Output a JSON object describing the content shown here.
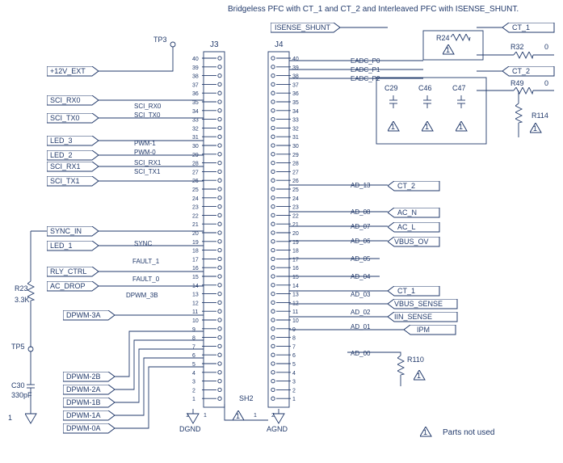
{
  "title": "Bridgeless PFC with CT_1 and CT_2 and Interleaved PFC with ISENSE_SHUNT.",
  "parts_note": "Parts not used",
  "refs": {
    "tp3": "TP3",
    "tp5": "TP5",
    "sh2": "SH2",
    "j3": "J3",
    "j4": "J4",
    "r23": "R23",
    "r23_val": "3.3K",
    "c30": "C30",
    "c30_val": "330pF",
    "r24": "R24",
    "r32": "R32",
    "r49": "R49",
    "r32_val": "0",
    "r49_val": "0",
    "r110": "R110",
    "r114": "R114",
    "c29": "C29",
    "c46": "C46",
    "c47": "C47",
    "dgnd": "DGND",
    "agnd": "AGND"
  },
  "triangle_marks": {
    "r24": "1",
    "c29": "1",
    "c46": "1",
    "c47": "1",
    "r114": "1",
    "r110": "1",
    "legend": "1",
    "big": "1",
    "c30_gnd": "1"
  },
  "left_signals": {
    "plus12v": "+12V_EXT",
    "sci_rx0": "SCI_RX0",
    "sci_tx0": "SCI_TX0",
    "led3": "LED_3",
    "led2": "LED_2",
    "sci_rx1": "SCI_RX1",
    "sci_tx1": "SCI_TX1",
    "sync_in": "SYNC_IN",
    "led1": "LED_1",
    "rly_ctrl": "RLY_CTRL",
    "ac_drop": "AC_DROP",
    "dpwm3a": "DPWM-3A",
    "dpwm2b": "DPWM-2B",
    "dpwm2a": "DPWM-2A",
    "dpwm1b": "DPWM-1B",
    "dpwm1a": "DPWM-1A",
    "dpwm0a": "DPWM-0A",
    "isense_shunt": "ISENSE_SHUNT"
  },
  "net_labels_j3": {
    "sync": "SYNC",
    "fault1": "FAULT_1",
    "fault0": "FAULT_0",
    "dpwm3b": "DPWM_3B",
    "pwm1": "PWM-1",
    "pwm0": "PWM-0",
    "sci_rx0_n": "SCI_RX0",
    "sci_tx0_n": "SCI_TX0",
    "sci_rx1_n": "SCI_RX1",
    "sci_tx1_n": "SCI_TX1"
  },
  "net_labels_j4": {
    "eadc_p0": "EADC_P0",
    "eadc_p1": "EADC_P1",
    "eadc_p2": "EADC_P2",
    "ad13": "AD_13",
    "ad08": "AD_08",
    "ad07": "AD_07",
    "ad06": "AD_06",
    "ad05": "AD_05",
    "ad04": "AD_04",
    "ad03": "AD_03",
    "ad02": "AD_02",
    "ad01": "AD_01",
    "ad00": "AD_00"
  },
  "right_signals": {
    "ct1": "CT_1",
    "ct2": "CT_2",
    "ct2_mid": "CT_2",
    "ac_n": "AC_N",
    "ac_l": "AC_L",
    "vbus_ov": "VBUS_OV",
    "ct1_mid": "CT_1",
    "vbus_sense": "VBUS_SENSE",
    "iin_sense": "IIN_SENSE",
    "ipm": "IPM"
  },
  "j3_pins": [
    "40",
    "39",
    "38",
    "37",
    "36",
    "35",
    "34",
    "33",
    "32",
    "31",
    "30",
    "29",
    "28",
    "27",
    "26",
    "25",
    "24",
    "23",
    "22",
    "21",
    "20",
    "19",
    "18",
    "17",
    "16",
    "15",
    "14",
    "13",
    "12",
    "11",
    "10",
    "9",
    "8",
    "7",
    "6",
    "5",
    "4",
    "3",
    "2",
    "1"
  ],
  "j4_pins": [
    "40",
    "39",
    "38",
    "37",
    "36",
    "35",
    "34",
    "33",
    "32",
    "31",
    "30",
    "29",
    "28",
    "27",
    "26",
    "25",
    "24",
    "23",
    "22",
    "21",
    "20",
    "19",
    "18",
    "17",
    "16",
    "15",
    "14",
    "13",
    "12",
    "11",
    "10",
    "9",
    "8",
    "7",
    "6",
    "5",
    "4",
    "3",
    "2",
    "1"
  ]
}
